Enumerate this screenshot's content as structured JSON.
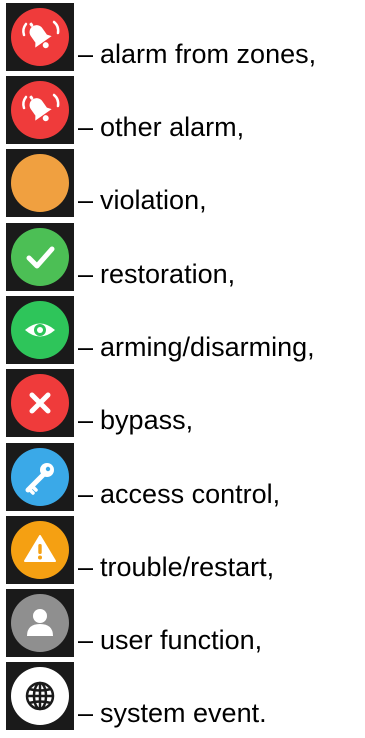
{
  "dash": "–",
  "items": [
    {
      "icon": "alarm-bell-icon",
      "color": "#ef3b3b",
      "text": "alarm from zones,"
    },
    {
      "icon": "alarm-bell-icon",
      "color": "#ef3b3b",
      "text": "other alarm,"
    },
    {
      "icon": "orange-circle-icon",
      "color": "#f0a040",
      "text": "violation,"
    },
    {
      "icon": "check-icon",
      "color": "#4cbf55",
      "text": "restoration,"
    },
    {
      "icon": "eye-icon",
      "color": "#2ec55a",
      "text": "arming/disarming,"
    },
    {
      "icon": "close-icon",
      "color": "#ef3b3b",
      "text": "bypass,"
    },
    {
      "icon": "key-icon",
      "color": "#3aa9e8",
      "text": "access control,"
    },
    {
      "icon": "warning-icon",
      "color": "#f5a012",
      "text": "trouble/restart,"
    },
    {
      "icon": "user-icon",
      "color": "#8f8f8f",
      "text": "user function,"
    },
    {
      "icon": "globe-icon",
      "color": "#ffffff",
      "text": "system event."
    }
  ]
}
